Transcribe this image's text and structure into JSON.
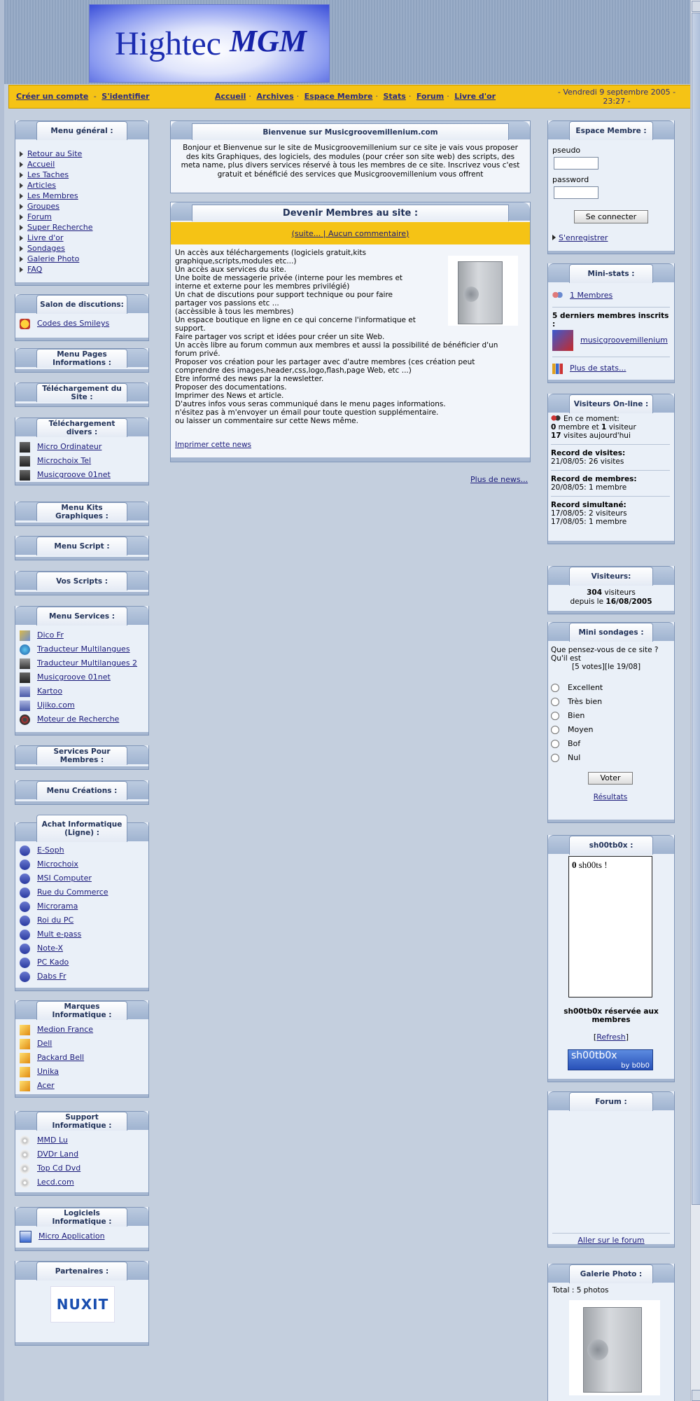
{
  "header": {
    "logo_part1": "Hightec",
    "logo_part2": "MGM"
  },
  "nav": {
    "create_account": "Créer un compte",
    "login": "S'identifier",
    "links": [
      "Accueil",
      "Archives",
      "Espace Membre",
      "Stats",
      "Forum",
      "Livre d'or"
    ],
    "date": "- Vendredi 9 septembre 2005 -",
    "time": "23:27 -"
  },
  "left": {
    "menu_general": {
      "title": "Menu général :",
      "items": [
        "Retour au Site",
        "Accueil",
        "Les Taches",
        "Articles",
        "Les Membres",
        "Groupes",
        "Forum",
        "Super Recherche",
        "Livre d'or",
        "Sondages",
        "Galerie Photo",
        "FAQ"
      ]
    },
    "salon": {
      "title": "Salon de discutions:",
      "items": [
        "Codes des Smileys"
      ]
    },
    "pages_info": {
      "title": "Menu Pages Informations :"
    },
    "telechargement_site": {
      "title": "Téléchargement du Site :"
    },
    "telechargement_divers": {
      "title": "Téléchargement divers :",
      "items": [
        "Micro Ordinateur",
        "Microchoix Tel",
        "Musicgroove 01net"
      ]
    },
    "kits": {
      "title": "Menu Kits Graphiques :"
    },
    "script": {
      "title": "Menu Script :"
    },
    "vos_scripts": {
      "title": "Vos Scripts :"
    },
    "services": {
      "title": "Menu Services :",
      "items": [
        "Dico Fr",
        "Traducteur Multilangues",
        "Traducteur Multilangues 2",
        "Musicgroove 01net",
        "Kartoo",
        "Ujiko.com",
        "Moteur de Recherche"
      ]
    },
    "services_membres": {
      "title": "Services Pour Membres :"
    },
    "creations": {
      "title": "Menu Créations :"
    },
    "achat": {
      "title": "Achat Informatique (Ligne) :",
      "items": [
        "E-Soph",
        "Microchoix",
        "MSI Computer",
        "Rue du Commerce",
        "Microrama",
        "Roi du PC",
        "Mult e-pass",
        "Note-X",
        "PC Kado",
        "Dabs Fr"
      ]
    },
    "marques": {
      "title": "Marques Informatique :",
      "items": [
        "Medion France",
        "Dell",
        "Packard Bell",
        "Unika",
        "Acer"
      ]
    },
    "support": {
      "title": "Support Informatique :",
      "items": [
        "MMD Lu",
        "DVDr Land",
        "Top Cd Dvd",
        "Lecd.com"
      ]
    },
    "logiciels": {
      "title": "Logiciels Informatique :",
      "items": [
        "Micro Application"
      ]
    },
    "partenaires": {
      "title": "Partenaires :",
      "logo_text": "NUXIT"
    }
  },
  "center": {
    "welcome": {
      "title": "Bienvenue sur Musicgroovemillenium.com",
      "text": "Bonjour et Bienvenue sur le site de Musicgroovemillenium sur ce site je vais vous proposer des kits Graphiques, des logiciels, des modules (pour créer son site web) des scripts, des meta name, plus divers services réservé à tous les membres de ce site. Inscrivez vous c'est gratuit et bénéficié des services que Musicgroovemillenium vous offrent"
    },
    "news": {
      "title": "Devenir Membres au site :",
      "links_bar": "(suite... | Aucun commentaire)",
      "lines": [
        "Un accès aux téléchargements (logiciels gratuit,kits",
        "graphique,scripts,modules etc...)",
        "Un accès aux services du site.",
        "Une boite de messagerie privée (interne pour les membres et",
        "interne et externe pour les membres privilégié)",
        "Un chat de discutions pour support technique ou pour faire",
        "partager vos passions etc ...",
        "(accèssible à tous les membres)",
        "Un espace boutique en ligne en ce qui concerne l'informatique et",
        "support.",
        "Faire partager vos script et idées pour créer un site Web.",
        "Un accès libre au forum commun aux membres et aussi la possibilité de bénéficier d'un",
        "forum privé.",
        "Proposer vos création pour les partager avec d'autre membres (ces création peut",
        "comprendre des images,header,css,logo,flash,page Web, etc ...)",
        "Etre informé des news par la newsletter.",
        "Proposer des documentations.",
        "Imprimer des News et article.",
        "D'autres infos vous seras communiqué dans le menu pages informations.",
        "n'ésitez pas à m'envoyer un émail pour toute question supplémentaire.",
        "ou laisser un commentaire sur cette News même."
      ],
      "print": "Imprimer cette news"
    },
    "more_news": "Plus de news..."
  },
  "right": {
    "espace": {
      "title": "Espace Membre :",
      "pseudo_label": "pseudo",
      "password_label": "password",
      "login_button": "Se connecter",
      "register": "S'enregistrer"
    },
    "ministats": {
      "title": "Mini-stats :",
      "members_link": "1 Membres",
      "last_members_label": "5 derniers membres inscrits :",
      "last_member": "musicgroovemillenium",
      "more_stats": "Plus de stats..."
    },
    "visiteurs_online": {
      "title": "Visiteurs On-line :",
      "now": "En ce moment:",
      "members_count": "0",
      "members_word": "membre et",
      "visitors_count": "1",
      "visitors_word": "visiteur",
      "today_count": "17",
      "today_word": "visites aujourd'hui",
      "record_visits_label": "Record de visites:",
      "record_visits": "21/08/05: 26 visites",
      "record_members_label": "Record de membres:",
      "record_members": "20/08/05: 1 membre",
      "record_sim_label": "Record simultané:",
      "record_sim_1": "17/08/05: 2 visiteurs",
      "record_sim_2": "17/08/05: 1 membre"
    },
    "visiteurs": {
      "title": "Visiteurs:",
      "count": "304",
      "count_word": "visiteurs",
      "since_word": "depuis le",
      "since_date": "16/08/2005"
    },
    "sondage": {
      "title": "Mini sondages :",
      "question": "Que pensez-vous de ce site ? Qu'il est",
      "votes": "[5 votes][le 19/08]",
      "options": [
        "Excellent",
        "Très bien",
        "Bien",
        "Moyen",
        "Bof",
        "Nul"
      ],
      "vote_button": "Voter",
      "results": "Résultats"
    },
    "shoutbox": {
      "title": "sh00tb0x :",
      "count": "0",
      "count_word": "sh00ts !",
      "reserved": "sh00tb0x réservée aux membres",
      "refresh": "Refresh",
      "badge_main": "sh00tb0x",
      "badge_sub": "by b0b0"
    },
    "forum": {
      "title": "Forum :",
      "link": "Aller sur le forum"
    },
    "galerie": {
      "title": "Galerie Photo :",
      "total": "Total : 5 photos"
    }
  },
  "colors": {
    "navbar": "#f5c315",
    "link": "#1a1a7a",
    "box_bg": "#eaf0f8",
    "border": "#8096b8"
  }
}
